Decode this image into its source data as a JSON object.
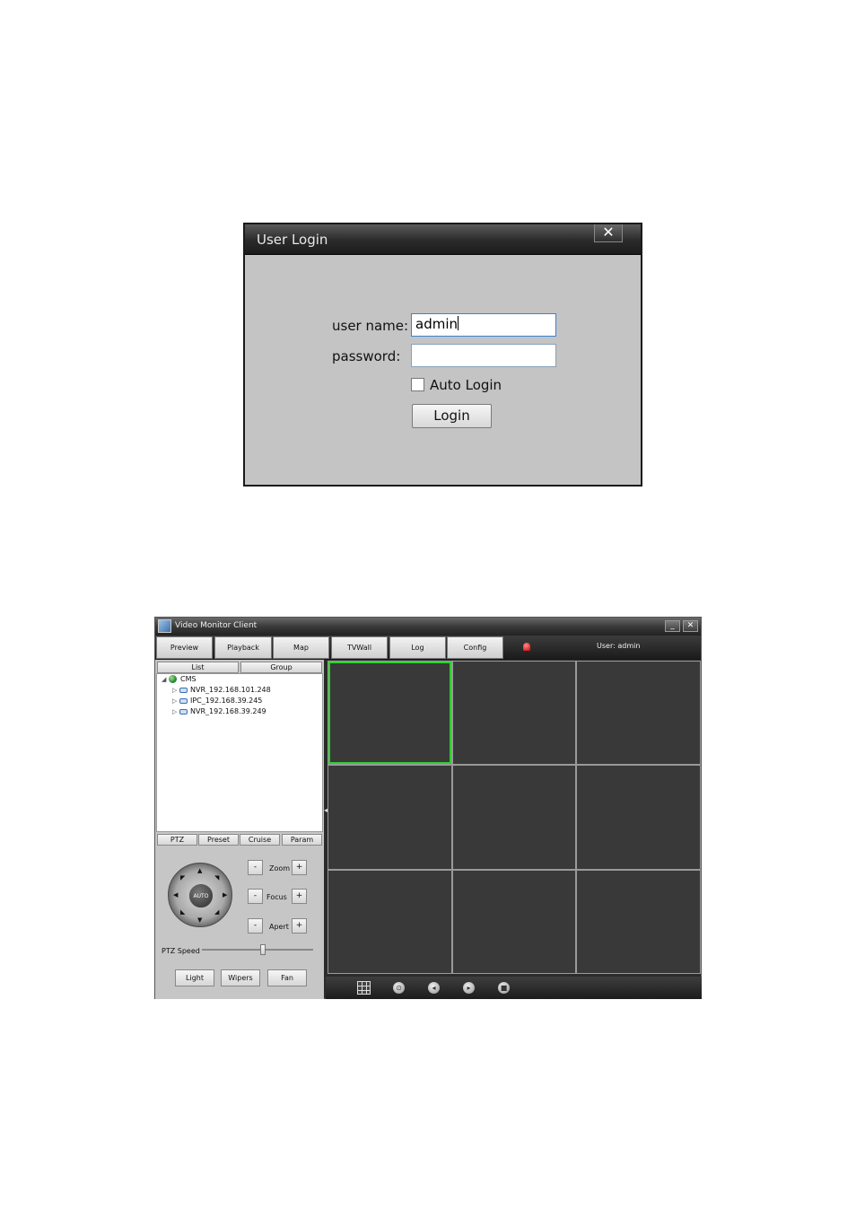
{
  "login": {
    "title": "User Login",
    "close_glyph": "✕",
    "username_label": "user name:",
    "username_value": "admin",
    "password_label": "password:",
    "password_value": "",
    "auto_login_label": "Auto Login",
    "auto_login_checked": false,
    "login_button": "Login"
  },
  "client": {
    "title": "Video Monitor Client",
    "minimize_glyph": "_",
    "close_glyph": "✕",
    "tabs": [
      "Preview",
      "Playback",
      "Map",
      "TVWall",
      "Log",
      "Config"
    ],
    "user_text": "User: admin",
    "alarm_icon": "alarm-bell-icon",
    "panel_tabs": [
      "List",
      "Group"
    ],
    "tree": {
      "root": "CMS",
      "children": [
        "NVR_192.168.101.248",
        "IPC_192.168.39.245",
        "NVR_192.168.39.249"
      ]
    },
    "control_tabs": [
      "PTZ",
      "Preset",
      "Cruise",
      "Param"
    ],
    "ptz_center": "AUTO",
    "adjust": [
      {
        "label": "Zoom",
        "minus": "-",
        "plus": "+"
      },
      {
        "label": "Focus",
        "minus": "-",
        "plus": "+"
      },
      {
        "label": "Apert",
        "minus": "-",
        "plus": "+"
      }
    ],
    "ptz_speed_label": "PTZ Speed",
    "ptz_speed_level": 0.55,
    "aux_buttons": [
      "Light",
      "Wipers",
      "Fan"
    ],
    "video_grid": {
      "rows": 3,
      "cols": 3,
      "selected_index": 0
    },
    "selected_color": "#2fd02f",
    "bottom_icons": [
      "layout-icon",
      "capture-icon",
      "previous-icon",
      "next-icon",
      "stop-icon"
    ]
  }
}
